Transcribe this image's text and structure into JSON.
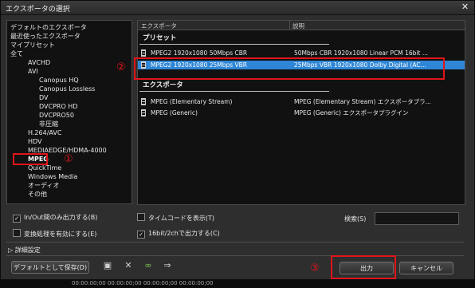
{
  "window": {
    "title": "エクスポータの選択",
    "close": "✕"
  },
  "tree": {
    "items": [
      {
        "label": "デフォルトのエクスポータ"
      },
      {
        "label": "最近使ったエクスポータ"
      },
      {
        "label": "マイプリセット"
      },
      {
        "label": "全て"
      },
      {
        "label": "AVCHD"
      },
      {
        "label": "AVI"
      },
      {
        "label": "Canopus HQ"
      },
      {
        "label": "Canopus Lossless"
      },
      {
        "label": "DV"
      },
      {
        "label": "DVCPRO HD"
      },
      {
        "label": "DVCPRO50"
      },
      {
        "label": "非圧縮"
      },
      {
        "label": "H.264/AVC"
      },
      {
        "label": "HDV"
      },
      {
        "label": "MEDIAEDGE/HDMA-4000"
      },
      {
        "label": "MPEG"
      },
      {
        "label": "QuickTime"
      },
      {
        "label": "Windows Media"
      },
      {
        "label": "オーディオ"
      },
      {
        "label": "その他"
      }
    ]
  },
  "list": {
    "col_exporter": "エクスポータ",
    "col_desc": "説明",
    "preset_header": "プリセット",
    "exporter_header": "エクスポータ",
    "presets": [
      {
        "name": "MPEG2 1920x1080 50Mbps CBR",
        "desc": "50Mbps CBR 1920x1080 Linear PCM 16bit ..."
      },
      {
        "name": "MPEG2 1920x1080 25Mbps VBR",
        "desc": "25Mbps VBR 1920x1080 Dolby Digital (AC..."
      }
    ],
    "exporters": [
      {
        "name": "MPEG (Elementary Stream)",
        "desc": "MPEG (Elementary Stream) エクスポータプラ..."
      },
      {
        "name": "MPEG (Generic)",
        "desc": "MPEG (Generic) エクスポータプラグイン"
      }
    ]
  },
  "options": {
    "inout": "In/Out間のみ出力する(B)",
    "inout_checked": true,
    "convert": "変換処理を有効にする(E)",
    "convert_checked": false,
    "timecode": "タイムコードを表示(T)",
    "timecode_checked": false,
    "bit16": "16bit/2chで出力する(C)",
    "bit16_checked": true
  },
  "search": {
    "label": "検索(S)",
    "value": ""
  },
  "advanced": "詳細設定",
  "buttons": {
    "save_default": "デフォルトとして保存(D)",
    "output": "出力",
    "cancel": "キャンセル"
  },
  "annotations": {
    "one": "①",
    "two": "②",
    "three": "③"
  },
  "status_text": "00:00:00;00   00:00:00;00   00:00:00;00   00:00:00;00"
}
